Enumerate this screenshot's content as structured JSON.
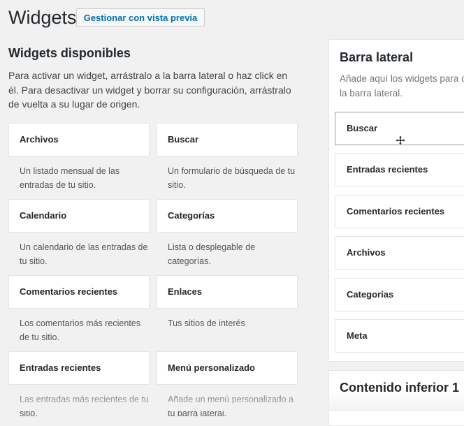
{
  "header": {
    "title": "Widgets",
    "manage_button": "Gestionar con vista previa"
  },
  "available": {
    "title": "Widgets disponibles",
    "description": "Para activar un widget, arrástralo a la barra lateral o haz click en él. Para desactivar un widget y borrar su configuración, arrástralo de vuelta a su lugar de origen.",
    "widgets": [
      {
        "name": "Archivos",
        "description": "Un listado mensual de las entradas de tu sitio."
      },
      {
        "name": "Buscar",
        "description": "Un formulario de búsqueda de tu sitio."
      },
      {
        "name": "Calendario",
        "description": "Un calendario de las entradas de tu sitio."
      },
      {
        "name": "Categorías",
        "description": "Lista o desplegable de categorías."
      },
      {
        "name": "Comentarios recientes",
        "description": "Los comentarios más recientes de tu sitio."
      },
      {
        "name": "Enlaces",
        "description": "Tus sitios de interés"
      },
      {
        "name": "Entradas recientes",
        "description": "Las entradas más recientes de tu sitio."
      },
      {
        "name": "Menú personalizado",
        "description": "Añade un menú personalizado a tu barra lateral."
      }
    ]
  },
  "sidebar": {
    "title": "Barra lateral",
    "description_line1": "Añade aquí los widgets para c",
    "description_line2": "la barra lateral.",
    "items": [
      "Buscar",
      "Entradas recientes",
      "Comentarios recientes",
      "Archivos",
      "Categorías",
      "Meta"
    ]
  },
  "bottom": {
    "title": "Contenido inferior 1"
  }
}
